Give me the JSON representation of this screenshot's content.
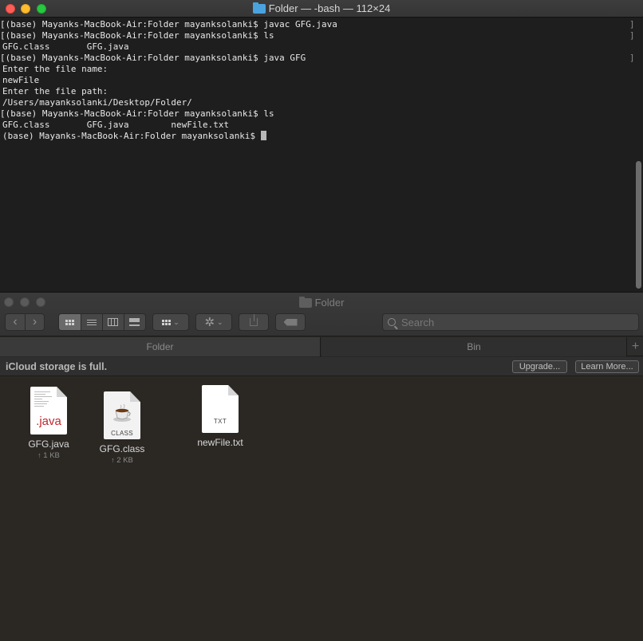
{
  "terminal": {
    "title": "Folder — -bash — 112×24",
    "lines": [
      "[(base) Mayanks-MacBook-Air:Folder mayanksolanki$ javac GFG.java",
      "[(base) Mayanks-MacBook-Air:Folder mayanksolanki$ ls",
      "GFG.class       GFG.java",
      "[(base) Mayanks-MacBook-Air:Folder mayanksolanki$ java GFG",
      "Enter the file name:",
      "newFile",
      "Enter the file path:",
      "/Users/mayanksolanki/Desktop/Folder/",
      "[(base) Mayanks-MacBook-Air:Folder mayanksolanki$ ls",
      "GFG.class       GFG.java        newFile.txt",
      "(base) Mayanks-MacBook-Air:Folder mayanksolanki$ "
    ],
    "marks": [
      "]",
      "]",
      "",
      "]"
    ]
  },
  "finder": {
    "title": "Folder",
    "search_placeholder": "Search",
    "tabs": [
      {
        "label": "Folder"
      },
      {
        "label": "Bin"
      }
    ],
    "tab_add": "+",
    "notice": {
      "text": "iCloud storage is full.",
      "upgrade": "Upgrade...",
      "learn_more": "Learn More..."
    },
    "files": [
      {
        "name": "GFG.java",
        "badge": ".java",
        "size": "1 KB"
      },
      {
        "name": "GFG.class",
        "badge": "CLASS",
        "size": "2 KB"
      },
      {
        "name": "newFile.txt",
        "badge": "TXT",
        "size": ""
      }
    ],
    "icons": {
      "back": "‹",
      "forward": "›",
      "chevron": "⌄",
      "gear": "✲",
      "upload_arrow": "↑"
    }
  },
  "colors": {
    "terminal_bg": "#1e1e1e",
    "finder_bg": "#2b2824",
    "java_red": "#c1272d",
    "close_red": "#fd5f57",
    "minimize_yellow": "#febc2e",
    "zoom_green": "#28c840",
    "folder_blue": "#4aa3df"
  }
}
